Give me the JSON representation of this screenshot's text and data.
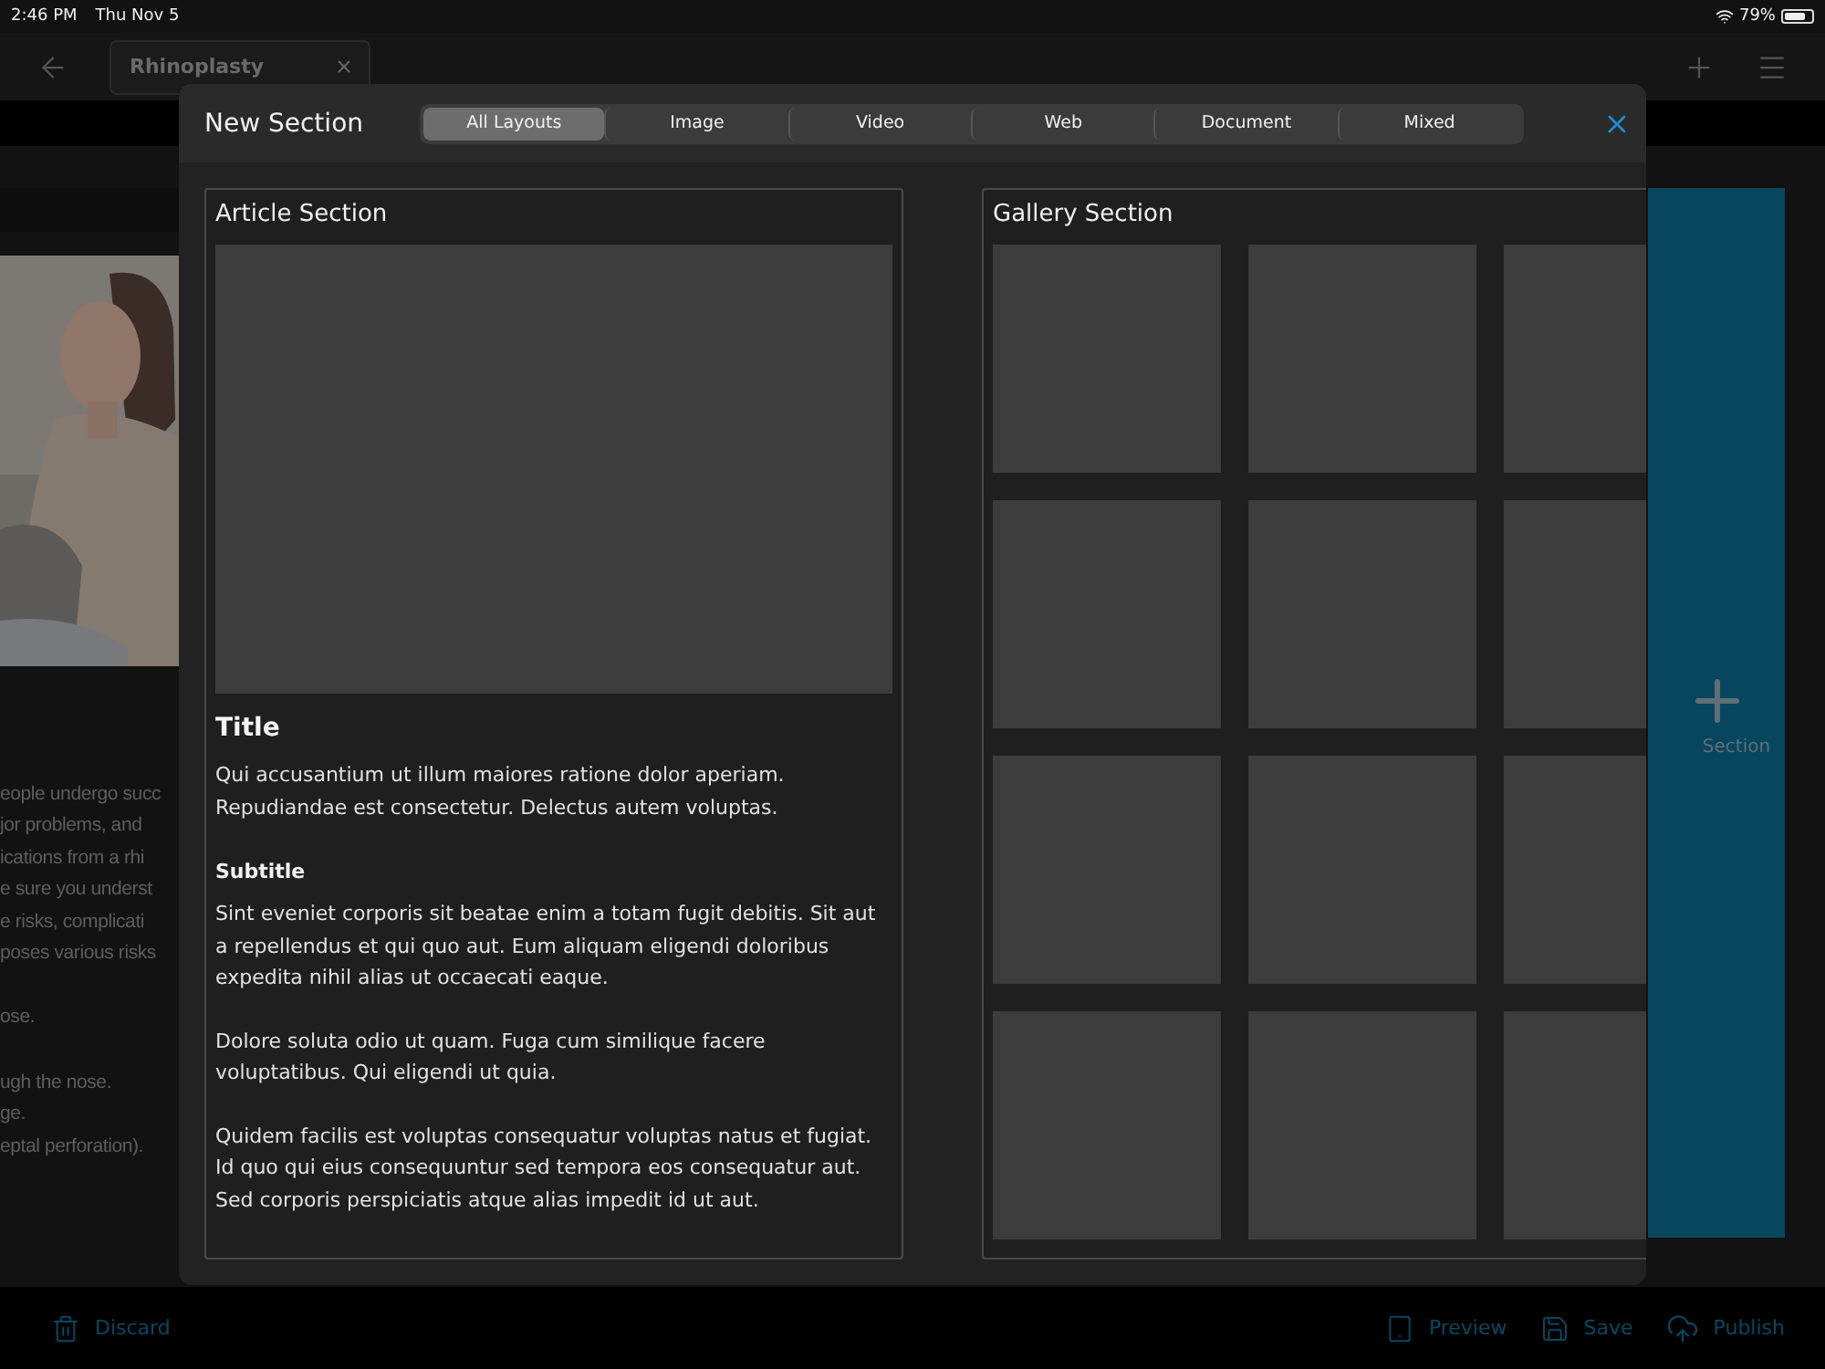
{
  "status_bar": {
    "time": "2:46 PM",
    "date": "Thu Nov 5",
    "battery": "79%"
  },
  "top_bar": {
    "tab": {
      "label": "Rhinoplasty"
    }
  },
  "background": {
    "text_groups": [
      [
        "eople undergo succ",
        "jor problems, and",
        "ications from a rhi",
        "e sure you underst",
        "e risks, complicati",
        "poses various risks"
      ],
      [
        "ose."
      ],
      [
        "ugh the nose.",
        "ge.",
        "eptal perforation)."
      ]
    ],
    "add_section_label": "Section"
  },
  "modal": {
    "title": "New Section",
    "segments": [
      {
        "label": "All Layouts",
        "selected": true
      },
      {
        "label": "Image",
        "selected": false
      },
      {
        "label": "Video",
        "selected": false
      },
      {
        "label": "Web",
        "selected": false
      },
      {
        "label": "Document",
        "selected": false
      },
      {
        "label": "Mixed",
        "selected": false
      }
    ],
    "article_card": {
      "title": "Article Section",
      "blocks": [
        {
          "kind": "heading",
          "text": "Title"
        },
        {
          "kind": "paragraph",
          "text": "Qui accusantium ut illum maiores ratione dolor aperiam. Repudiandae est consectetur. Delectus autem voluptas."
        },
        {
          "kind": "subheading",
          "text": "Subtitle"
        },
        {
          "kind": "paragraph",
          "text": "Sint eveniet corporis sit beatae enim a totam fugit debitis. Sit aut a repellendus et qui quo aut. Eum aliquam eligendi doloribus expedita nihil alias ut occaecati eaque."
        },
        {
          "kind": "paragraph",
          "text": "Dolore soluta odio ut quam. Fuga cum similique facere voluptatibus. Qui eligendi ut quia."
        },
        {
          "kind": "paragraph",
          "text": "Quidem facilis est voluptas consequatur voluptas natus et fugiat. Id quo qui eius consequuntur sed tempora eos consequatur aut. Sed corporis perspiciatis atque alias impedit id ut aut."
        }
      ]
    },
    "gallery_card": {
      "title": "Gallery Section"
    }
  },
  "bottom_toolbar": {
    "left": [
      {
        "kind": "discard",
        "label": "Discard"
      }
    ],
    "right": [
      {
        "kind": "preview",
        "label": "Preview"
      },
      {
        "kind": "save",
        "label": "Save"
      },
      {
        "kind": "publish",
        "label": "Publish"
      }
    ]
  }
}
